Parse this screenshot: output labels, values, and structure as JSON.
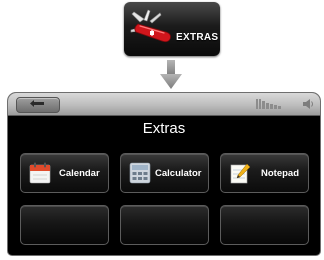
{
  "launcher": {
    "label": "EXTRAS",
    "icon": "swiss-knife-icon"
  },
  "arrow": {
    "icon": "down-arrow-icon"
  },
  "status_bar": {
    "back_icon": "back-arrow-icon",
    "signal_icon": "signal-icon",
    "volume_icon": "speaker-icon"
  },
  "screen": {
    "title": "Extras",
    "tiles": [
      {
        "label": "Calendar",
        "icon": "calendar-icon"
      },
      {
        "label": "Calculator",
        "icon": "calculator-icon"
      },
      {
        "label": "Notepad",
        "icon": "notepad-icon"
      },
      {
        "label": ""
      },
      {
        "label": ""
      },
      {
        "label": ""
      }
    ]
  },
  "colors": {
    "screen_bg": "#000000",
    "tile_bg": "#1c1c1c",
    "status_bar": "#bdbdbd",
    "knife_red": "#d0161c"
  }
}
